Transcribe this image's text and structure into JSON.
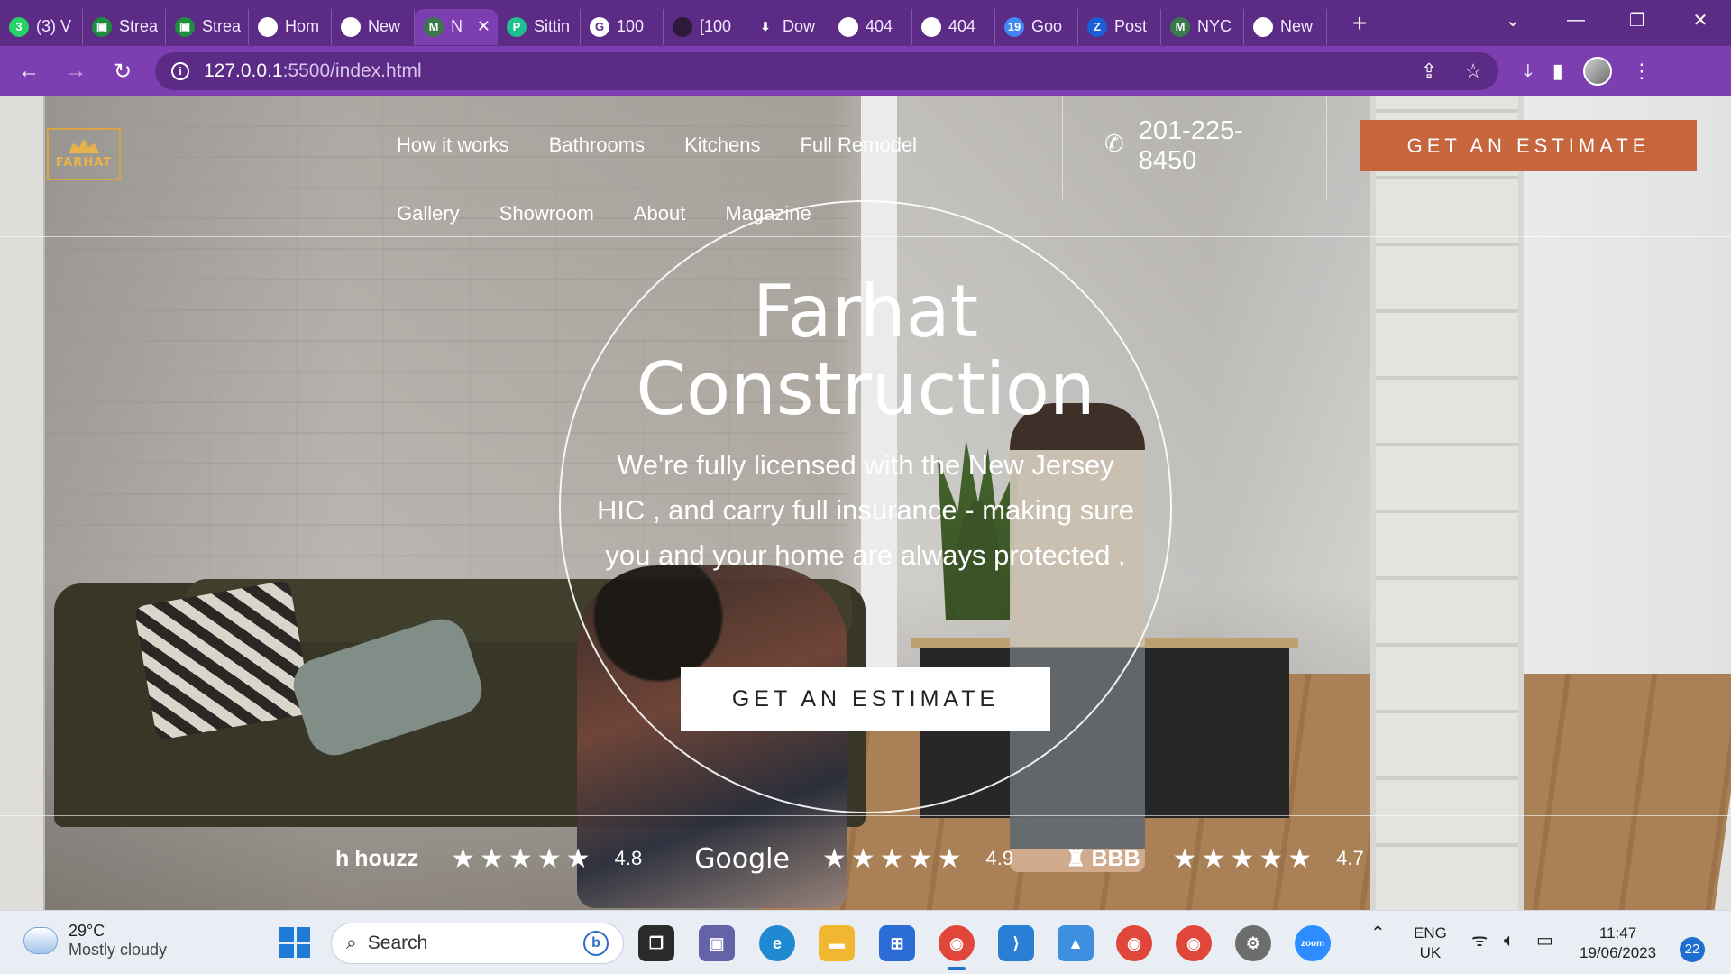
{
  "browser": {
    "tabs": [
      {
        "title": "(3) V",
        "icon": "whatsapp-icon",
        "color": "#25d366",
        "glyph": "3"
      },
      {
        "title": "Strea",
        "icon": "classroom-icon",
        "color": "#1e8e3e",
        "glyph": "▣"
      },
      {
        "title": "Strea",
        "icon": "classroom-icon",
        "color": "#1e8e3e",
        "glyph": "▣"
      },
      {
        "title": "Hom",
        "icon": "globe-icon",
        "color": "#ffffff",
        "glyph": ""
      },
      {
        "title": "New",
        "icon": "chrome-icon",
        "color": "#ffffff",
        "glyph": ""
      },
      {
        "title": "N",
        "icon": "mobirise-icon",
        "color": "#3a7a4a",
        "glyph": "M",
        "active": true
      },
      {
        "title": "Sittin",
        "icon": "docs-icon",
        "color": "#1fbf8f",
        "glyph": "P"
      },
      {
        "title": "100",
        "icon": "google-icon",
        "color": "#ffffff",
        "glyph": "G"
      },
      {
        "title": "[100",
        "icon": "stripe-icon",
        "color": "#2b1a3a",
        "glyph": ""
      },
      {
        "title": "Dow",
        "icon": "download-icon",
        "color": "#5c2b86",
        "glyph": "⬇"
      },
      {
        "title": "404",
        "icon": "globe-icon",
        "color": "#ffffff",
        "glyph": ""
      },
      {
        "title": "404",
        "icon": "globe-icon",
        "color": "#ffffff",
        "glyph": ""
      },
      {
        "title": "Goo",
        "icon": "calendar-icon",
        "color": "#4285f4",
        "glyph": "19"
      },
      {
        "title": "Post",
        "icon": "zed-icon",
        "color": "#1a5fd8",
        "glyph": "Z"
      },
      {
        "title": "NYC",
        "icon": "mobirise-icon",
        "color": "#3a7a4a",
        "glyph": "M"
      },
      {
        "title": "New",
        "icon": "chrome-icon",
        "color": "#ffffff",
        "glyph": ""
      }
    ],
    "url_host": "127.0.0.1",
    "url_path": ":5500/index.html"
  },
  "site": {
    "logo_text": "FARHAT",
    "nav_row1": [
      "How it works",
      "Bathrooms",
      "Kitchens",
      "Full Remodel"
    ],
    "nav_row2": [
      "Gallery",
      "Showroom",
      "About",
      "Magazine"
    ],
    "phone_line1": "201-225-",
    "phone_line2": "8450",
    "cta_top": "GET AN ESTIMATE",
    "hero_title_line1": "Farhat",
    "hero_title_line2": "Construction",
    "hero_subtitle": "We're fully licensed with the New Jersey HIC , and carry full insurance - making sure you and your home are always protected .",
    "cta_hero": "GET AN ESTIMATE",
    "ratings": [
      {
        "brand": "houzz",
        "stars": "★★★★★",
        "score": "4.8"
      },
      {
        "brand": "Google",
        "stars": "★★★★★",
        "score": "4.9"
      },
      {
        "brand": "BBB",
        "stars": "★★★★★",
        "score": "4.7"
      }
    ],
    "accent_color": "#c7653d"
  },
  "taskbar": {
    "temperature": "29°C",
    "weather": "Mostly cloudy",
    "search_placeholder": "Search",
    "lang1": "ENG",
    "lang2": "UK",
    "time": "11:47",
    "date": "19/06/2023",
    "notifications": "22",
    "zoom_label": "zoom"
  }
}
